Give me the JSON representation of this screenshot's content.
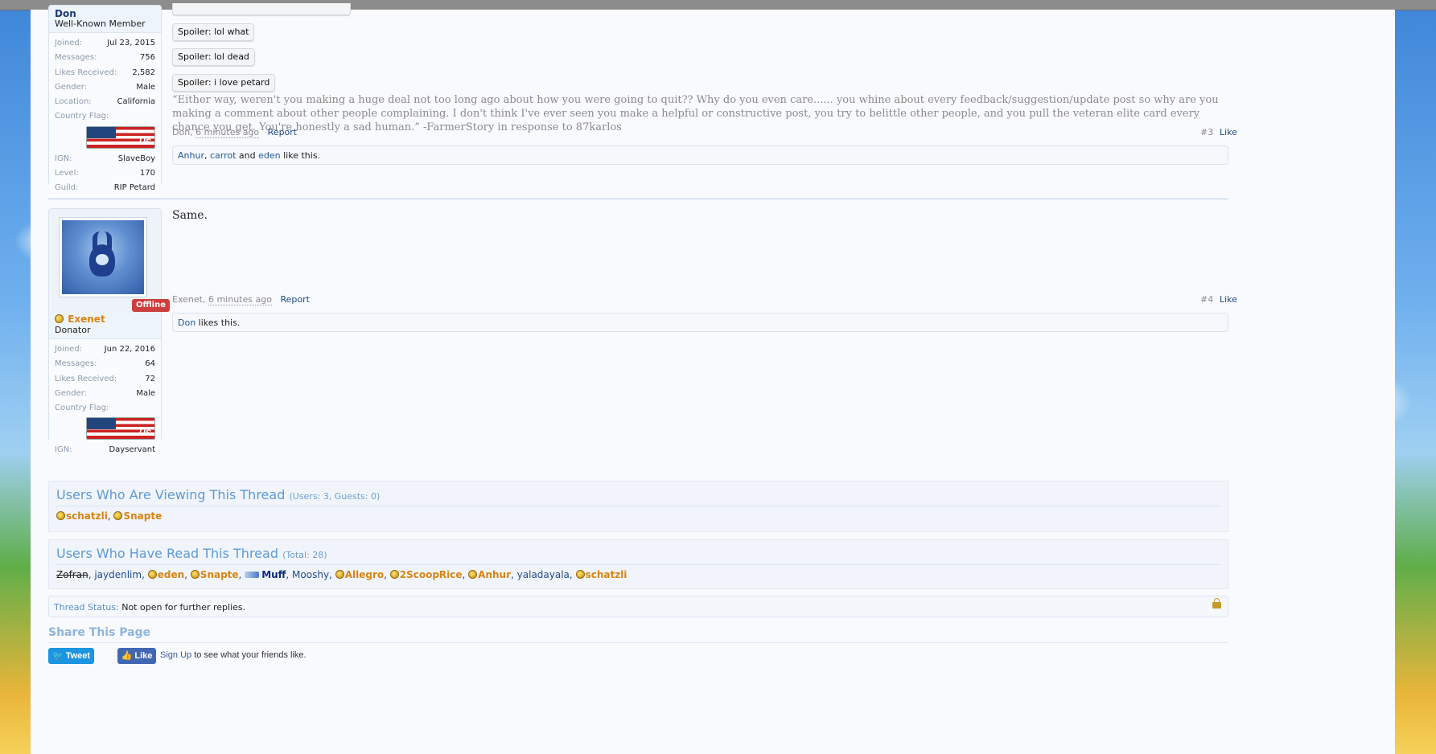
{
  "post3": {
    "author_name": "Don",
    "author_title": "Well-Known Member",
    "stats": [
      {
        "k": "Joined:",
        "v": "Jul 23, 2015"
      },
      {
        "k": "Messages:",
        "v": "756"
      },
      {
        "k": "Likes Received:",
        "v": "2,582"
      },
      {
        "k": "Gender:",
        "v": "Male"
      },
      {
        "k": "Location:",
        "v": "California"
      },
      {
        "k": "Country Flag:",
        "v": ""
      }
    ],
    "flag_code": "US",
    "extra_stats": [
      {
        "k": "IGN:",
        "v": "SlaveBoy"
      },
      {
        "k": "Level:",
        "v": "170"
      },
      {
        "k": "Guild:",
        "v": "RIP Petard"
      }
    ],
    "spoilers": [
      "Spoiler: lol what",
      "Spoiler: lol dead",
      "Spoiler: i love petard"
    ],
    "quote": "“Either way, weren't you making a huge deal not too long ago about how you were going to quit?? Why do you even care...... you whine about every feedback/suggestion/update post so why are you making a comment about other people complaining. I don't think I've ever seen you make a helpful or constructive post, you try to belittle other people, and you pull the veteran elite card every chance you get. You're honestly a sad human.” -FarmerStory in response to 87karlos",
    "meta_author": "Don",
    "meta_time": "6 minutes ago",
    "report": "Report",
    "number": "#3",
    "like": "Like",
    "likes": {
      "u1": "Anhur",
      "sep1": ", ",
      "u2": "carrot",
      "and": " and ",
      "u3": "eden",
      "tail": " like this."
    }
  },
  "post4": {
    "author_name": "Exenet",
    "author_title": "Donator",
    "offline": "Offline",
    "stats": [
      {
        "k": "Joined:",
        "v": "Jun 22, 2016"
      },
      {
        "k": "Messages:",
        "v": "64"
      },
      {
        "k": "Likes Received:",
        "v": "72"
      },
      {
        "k": "Gender:",
        "v": "Male"
      },
      {
        "k": "Country Flag:",
        "v": ""
      }
    ],
    "flag_code": "US",
    "extra_stats": [
      {
        "k": "IGN:",
        "v": "Dayservant"
      }
    ],
    "body": "Same.",
    "meta_author": "Exenet",
    "meta_time": "6 minutes ago",
    "report": "Report",
    "number": "#4",
    "like": "Like",
    "likes": {
      "u1": "Don",
      "tail": " likes this."
    }
  },
  "viewing": {
    "title": "Users Who Are Viewing This Thread",
    "count": "(Users: 3, Guests: 0)",
    "users": [
      "schatzli",
      "Snapte"
    ]
  },
  "read": {
    "title": "Users Who Have Read This Thread",
    "count": "(Total: 28)",
    "users": [
      "Zofran",
      "jaydenlim",
      "eden",
      "Snapte",
      "Muff",
      "Mooshy",
      "Allegro",
      "2ScoopRice",
      "Anhur",
      "yaladayala",
      "schatzli"
    ]
  },
  "thread_status": {
    "label": "Thread Status:",
    "value": "Not open for further replies."
  },
  "share": {
    "title": "Share This Page",
    "tweet": "Tweet",
    "fb_like": "Like",
    "signup": "Sign Up",
    "signup_tail": " to see what your friends like."
  },
  "colors": {
    "accent": "#5d9ad6",
    "link": "#1f4a8a",
    "orange": "#d98411",
    "offline": "#cf3e3e"
  }
}
